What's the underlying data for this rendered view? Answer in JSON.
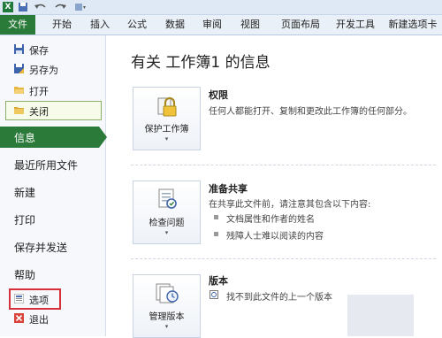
{
  "ribbon": {
    "tabs": [
      {
        "label": "文件"
      },
      {
        "label": "开始"
      },
      {
        "label": "插入"
      },
      {
        "label": "公式"
      },
      {
        "label": "数据"
      },
      {
        "label": "审阅"
      },
      {
        "label": "视图"
      },
      {
        "label": "页面布局"
      },
      {
        "label": "开发工具"
      },
      {
        "label": "新建选项卡"
      }
    ]
  },
  "sidebar": {
    "small_items": [
      {
        "label": "保存",
        "icon": "save-icon"
      },
      {
        "label": "另存为",
        "icon": "save-as-icon"
      },
      {
        "label": "打开",
        "icon": "open-folder-icon"
      },
      {
        "label": "关闭",
        "icon": "close-folder-icon"
      }
    ],
    "selected_item": "信息",
    "big_items": [
      {
        "label": "最近所用文件"
      },
      {
        "label": "新建"
      },
      {
        "label": "打印"
      },
      {
        "label": "保存并发送"
      },
      {
        "label": "帮助"
      }
    ],
    "bottom_items": [
      {
        "label": "选项",
        "icon": "options-icon"
      },
      {
        "label": "退出",
        "icon": "exit-icon"
      }
    ]
  },
  "main": {
    "title": "有关 工作簿1 的信息",
    "sections": [
      {
        "button_label": "保护工作簿",
        "heading": "权限",
        "description": "任何人都能打开、复制和更改此工作簿的任何部分。",
        "icon": "lock-icon"
      },
      {
        "button_label": "检查问题",
        "heading": "准备共享",
        "description": "在共享此文件前，请注意其包含以下内容:",
        "bullets": [
          "文档属性和作者的姓名",
          "残障人士难以阅读的内容"
        ],
        "icon": "checklist-icon"
      },
      {
        "button_label": "管理版本",
        "heading": "版本",
        "description": "找不到此文件的上一个版本",
        "icon": "versions-icon"
      }
    ]
  },
  "colors": {
    "file_tab": "#2a7a3a",
    "selected": "#2b7a3a",
    "highlight_border": "#d6313a"
  }
}
